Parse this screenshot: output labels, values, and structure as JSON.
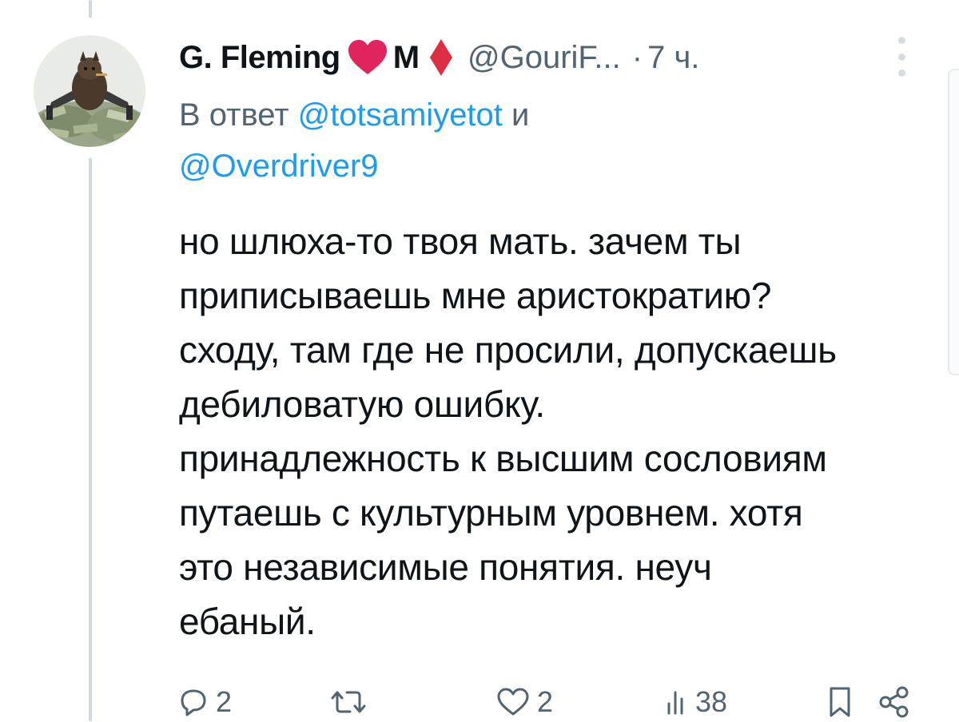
{
  "tweet": {
    "display_name": "G. Fleming",
    "name_suffix": "M",
    "handle": "@GouriF...",
    "dot": "·",
    "time": "7 ч.",
    "reply_prefix": "В ответ",
    "reply_mention_1": "@totsamiyetot",
    "reply_and": "и",
    "reply_mention_2": "@Overdriver9",
    "text": "но шлюха-то твоя мать. зачем ты\nприписываешь мне аристократию?\nсходу, там где не просили, допускаешь\nдебиловатую ошибку.\nпринадлежность к высшим сословиям\nпутаешь с культурным уровнем. хотя\nэто независимые понятия. неуч\nебаный."
  },
  "icons": {
    "avatar": "avatar-image",
    "heart": "red-heart-emoji",
    "diamond": "red-diamond-suit-emoji",
    "more": "more-vertical-icon",
    "reply": "reply-icon",
    "retweet": "retweet-icon",
    "like": "like-icon",
    "views": "views-icon",
    "bookmark": "bookmark-icon",
    "share": "share-icon"
  },
  "actions": {
    "reply_count": "2",
    "retweet_count": "",
    "like_count": "2",
    "views_count": "38"
  },
  "colors": {
    "text": "#0f1419",
    "secondary": "#536471",
    "link": "#1d9bf0",
    "heart": "#e0245e",
    "diamond": "#dd2e44",
    "thread_line": "#cfd9de"
  }
}
